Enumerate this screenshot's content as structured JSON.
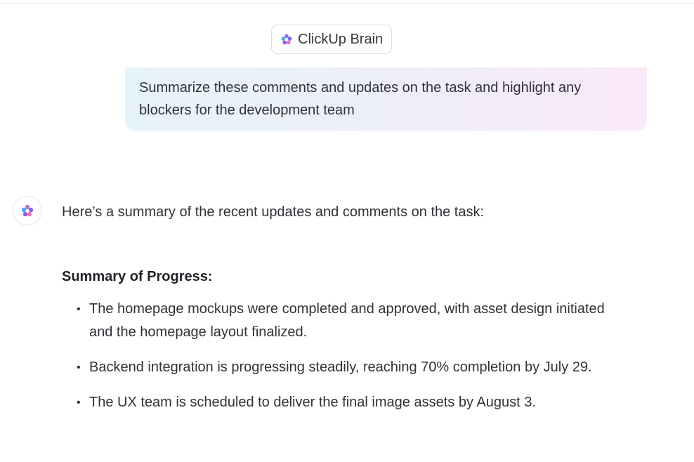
{
  "header": {
    "badge_label": "ClickUp Brain",
    "icon": "clickup-brain-icon"
  },
  "prompt": {
    "text": "Summarize these comments and updates on the task and highlight any blockers for the development team"
  },
  "response": {
    "avatar_icon": "clickup-brain-icon",
    "intro": "Here’s a summary of the recent updates and comments on the task:",
    "heading": "Summary of Progress:",
    "bullets": [
      {
        "text": "The homepage mockups were completed and approved, with asset design initiated and the homepage layout finalized."
      },
      {
        "text": "Backend integration is progressing steadily, reaching 70% completion by July 29."
      },
      {
        "text": "The UX team is scheduled to deliver the final image assets by August 3."
      }
    ]
  },
  "colors": {
    "badge_border": "#dcdde2",
    "prompt_gradient_start": "#e6f3fb",
    "prompt_gradient_end": "#fbe8f8",
    "brain_purple": "#7b68ee",
    "brain_pink": "#fd71af",
    "brain_blue": "#49ccf9"
  }
}
